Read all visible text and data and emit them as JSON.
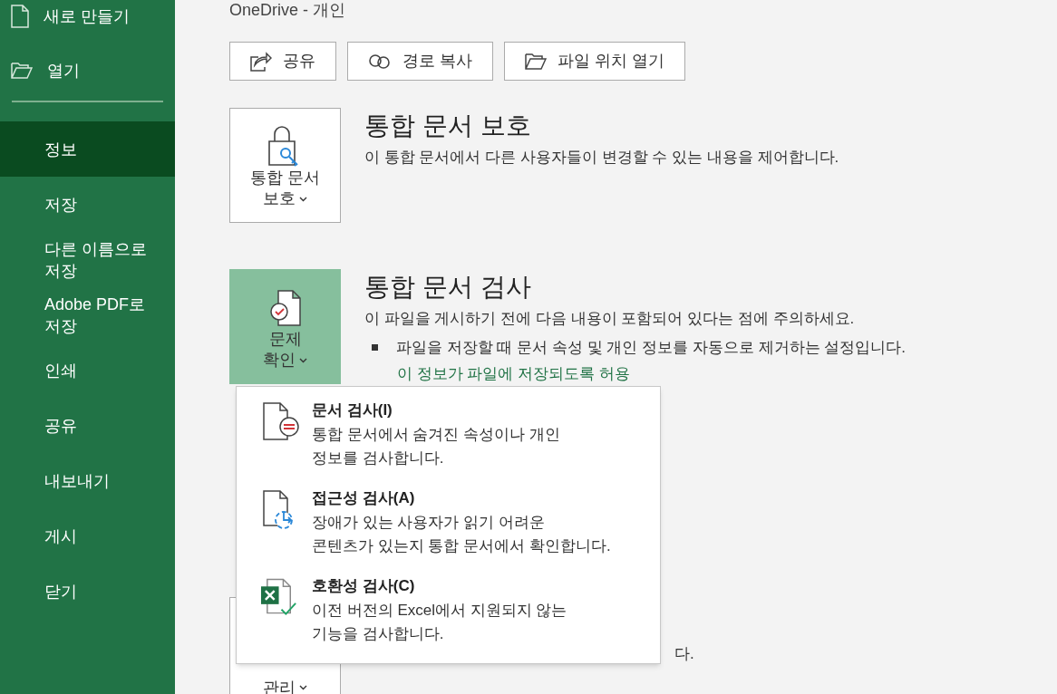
{
  "sidebar": {
    "items": [
      {
        "label": "새로 만들기",
        "kind": "document",
        "selected": false
      },
      {
        "label": "열기",
        "kind": "folder",
        "selected": false
      },
      {
        "label": "정보",
        "selected": true
      },
      {
        "label": "저장",
        "selected": false
      },
      {
        "label": "다른 이름으로 저장",
        "selected": false
      },
      {
        "label": "Adobe PDF로 저장",
        "selected": false
      },
      {
        "label": "인쇄",
        "selected": false
      },
      {
        "label": "공유",
        "selected": false
      },
      {
        "label": "내보내기",
        "selected": false
      },
      {
        "label": "게시",
        "selected": false
      },
      {
        "label": "닫기",
        "selected": false
      }
    ]
  },
  "location": "OneDrive - 개인",
  "actions": [
    {
      "label": "공유",
      "kind": "share"
    },
    {
      "label": "경로 복사",
      "kind": "link"
    },
    {
      "label": "파일 위치 열기",
      "kind": "folder"
    }
  ],
  "sections": [
    {
      "kind": "protect",
      "button": [
        "통합 문서",
        "보호"
      ],
      "active": false,
      "title": "통합 문서 보호",
      "description": "이 통합 문서에서 다른 사용자들이 변경할 수 있는 내용을 제어합니다."
    },
    {
      "kind": "inspect",
      "button": [
        "문제",
        "확인"
      ],
      "active": true,
      "title": "통합 문서 검사",
      "description": "이 파일을 게시하기 전에 다음 내용이 포함되어 있다는 점에 주의하세요.",
      "bullet": "파일을 저장할 때 문서 속성 및 개인 정보를 자동으로 제거하는 설정입니다.",
      "link": "이 정보가 파일에 저장되도록 허용"
    },
    {
      "kind": "manage",
      "button": [
        "관리"
      ],
      "active": false,
      "tail": "다."
    }
  ],
  "menu": [
    {
      "kind": "inspect",
      "title": "문서 검사(I)",
      "lines": [
        "통합 문서에서 숨겨진 속성이나 개인",
        "정보를 검사합니다."
      ]
    },
    {
      "kind": "accessibility",
      "title": "접근성 검사(A)",
      "lines": [
        "장애가 있는 사용자가 읽기 어려운",
        "콘텐츠가 있는지 통합 문서에서 확인합니다."
      ]
    },
    {
      "kind": "compat",
      "title": "호환성 검사(C)",
      "lines": [
        "이전 버전의 Excel에서 지원되지 않는",
        "기능을 검사합니다."
      ]
    }
  ]
}
